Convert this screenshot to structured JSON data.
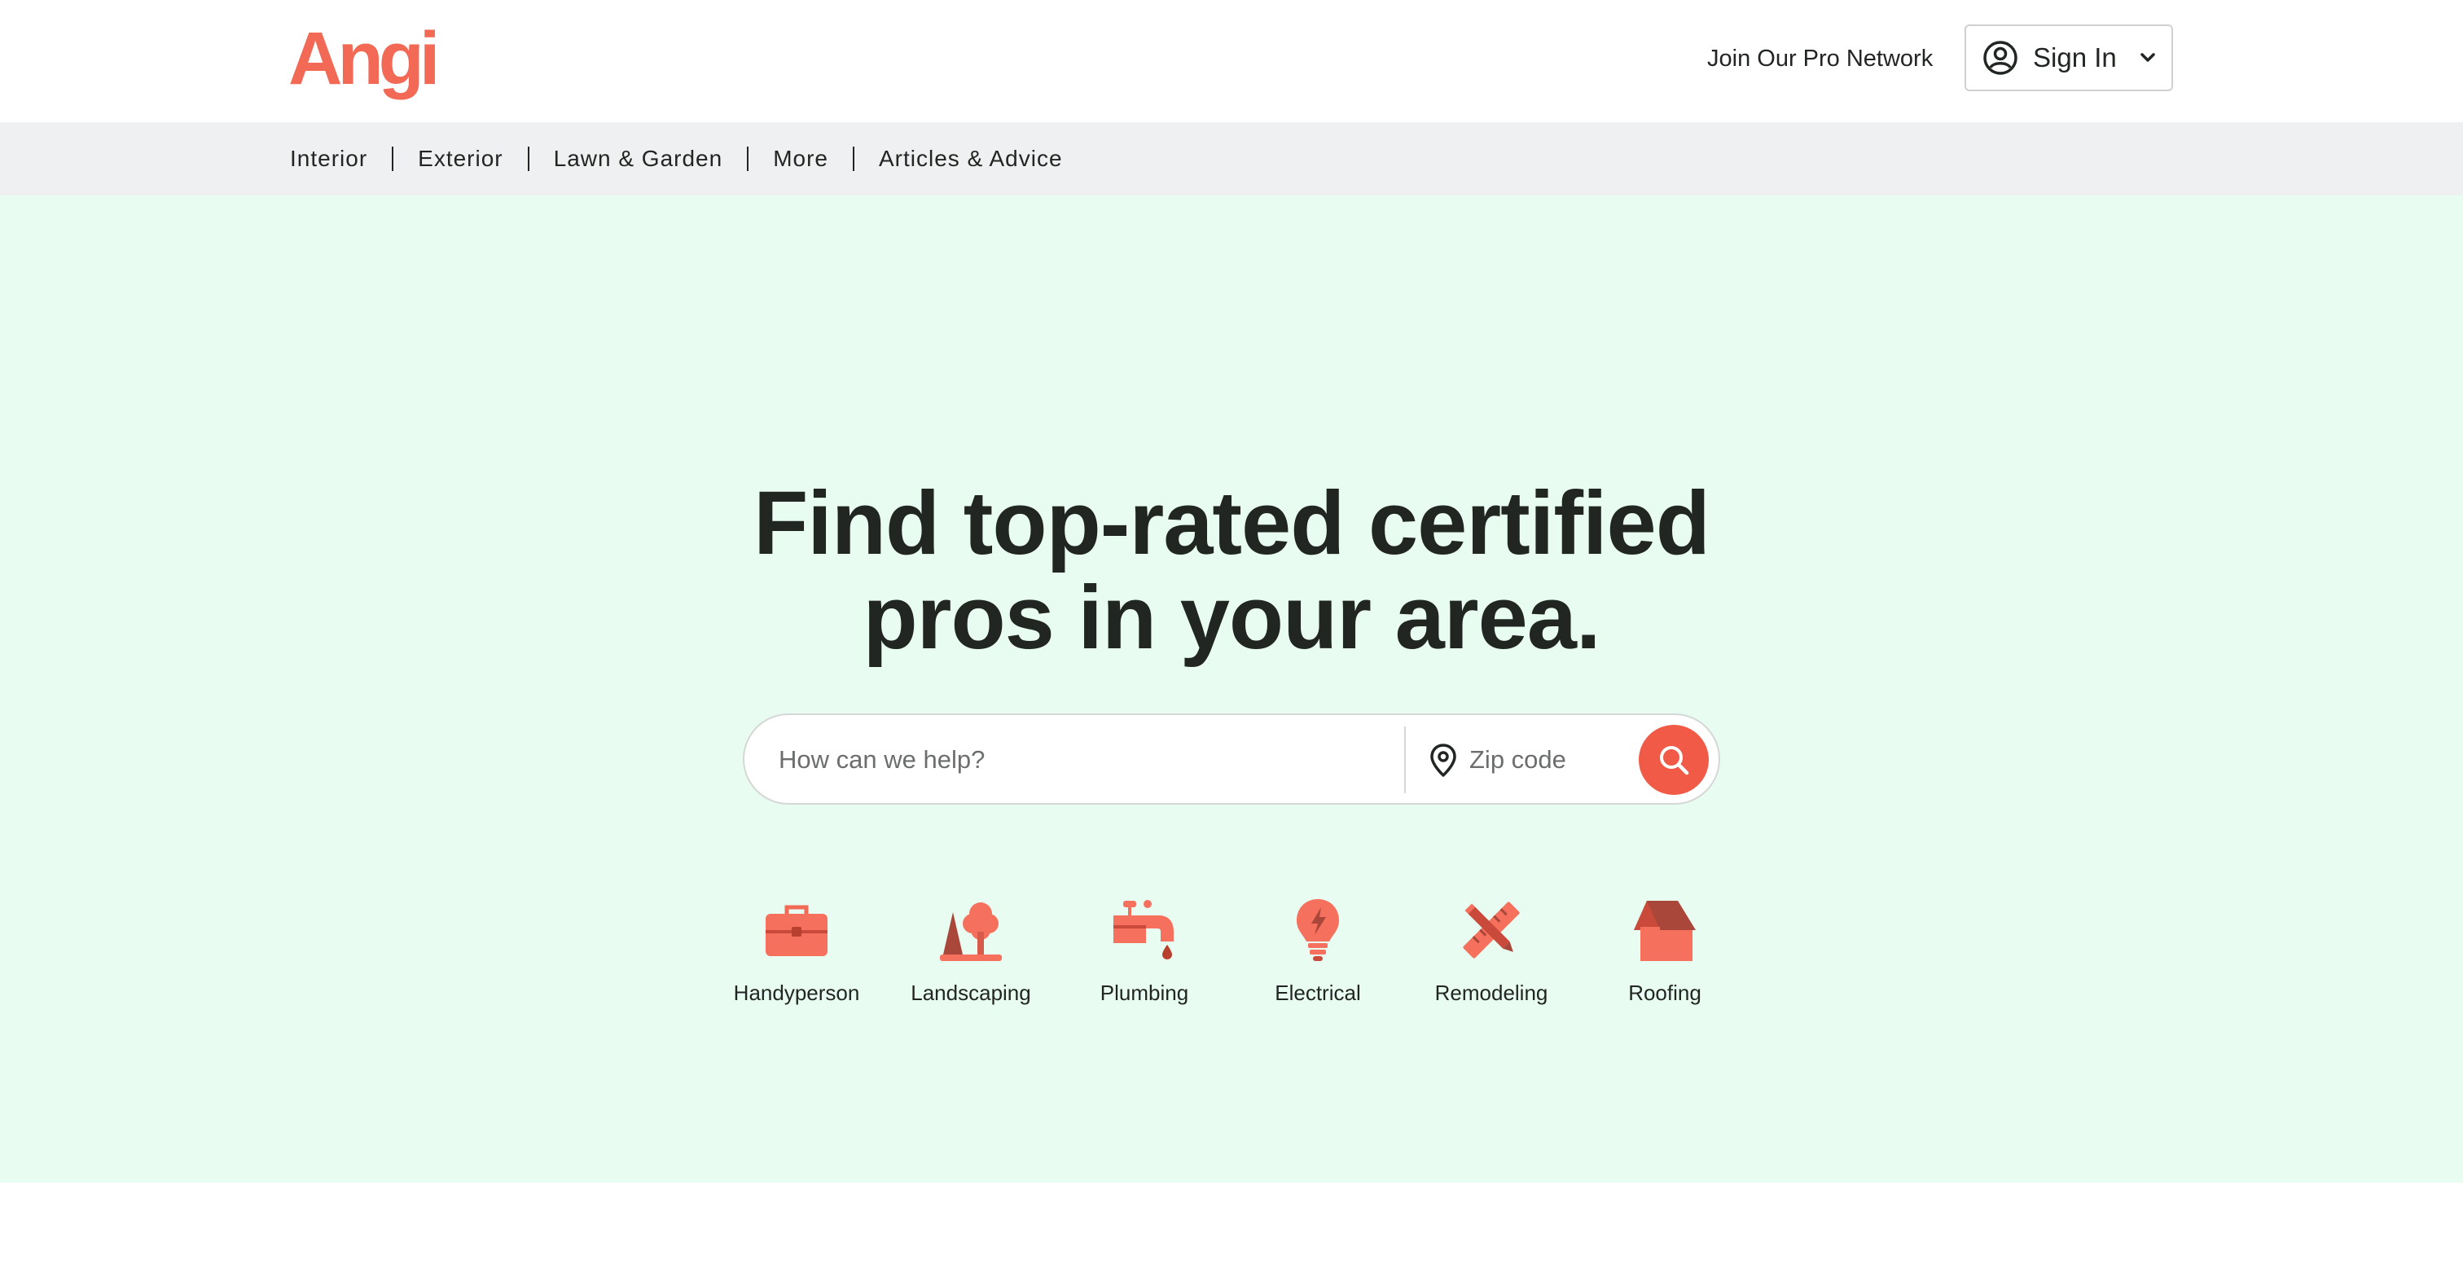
{
  "header": {
    "logo_text": "Angi",
    "join_label": "Join Our Pro Network",
    "signin_label": "Sign In"
  },
  "subnav": {
    "items": [
      {
        "label": "Interior"
      },
      {
        "label": "Exterior"
      },
      {
        "label": "Lawn & Garden"
      },
      {
        "label": "More"
      },
      {
        "label": "Articles & Advice"
      }
    ]
  },
  "hero": {
    "headline_line1": "Find top-rated certified",
    "headline_line2": "pros in your area."
  },
  "search": {
    "query_value": "",
    "query_placeholder": "How can we help?",
    "zip_value": "",
    "zip_placeholder": "Zip code"
  },
  "categories": [
    {
      "label": "Handyperson",
      "icon": "toolbox-icon"
    },
    {
      "label": "Landscaping",
      "icon": "tree-icon"
    },
    {
      "label": "Plumbing",
      "icon": "faucet-icon"
    },
    {
      "label": "Electrical",
      "icon": "lightbulb-icon"
    },
    {
      "label": "Remodeling",
      "icon": "ruler-pencil-icon"
    },
    {
      "label": "Roofing",
      "icon": "house-roof-icon"
    }
  ],
  "colors": {
    "brand": "#f26956",
    "hero_bg": "#e8fcf1",
    "subnav_bg": "#eff0f1",
    "search_button": "#f15a47",
    "text": "#222622"
  }
}
